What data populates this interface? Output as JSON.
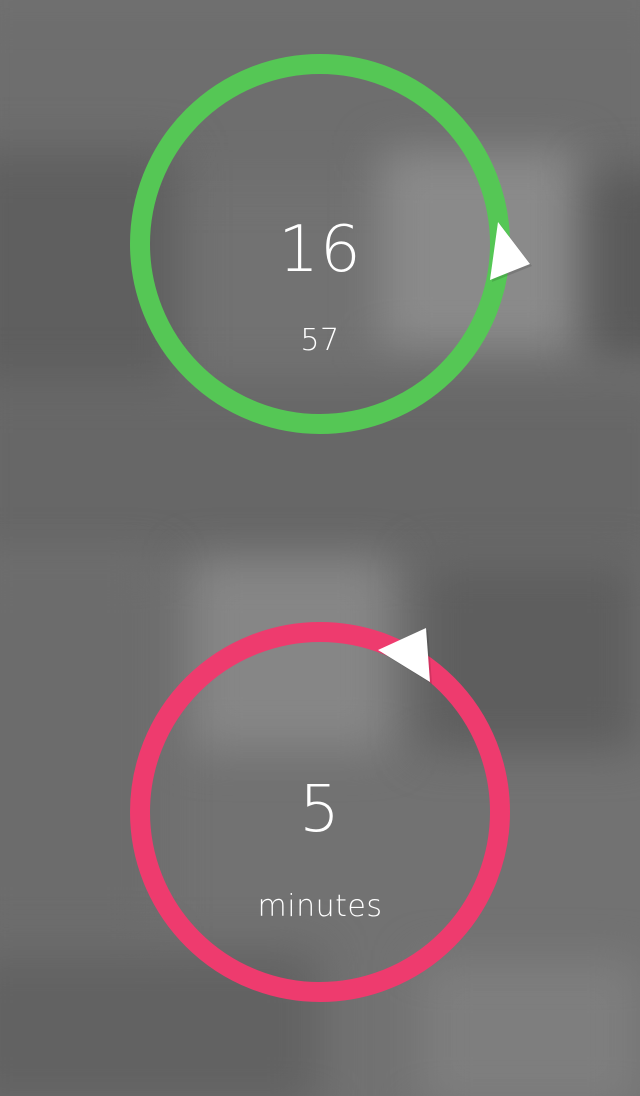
{
  "colors": {
    "background": "#727272",
    "elapsed_ring": "#55c755",
    "interval_ring": "#ee3b6e",
    "handle": "#ffffff",
    "text": "#ffffff"
  },
  "elapsed_timer": {
    "value": "16",
    "sub_value": "57",
    "handle_icon": "triangle-handle-icon"
  },
  "interval_timer": {
    "value": "5",
    "unit_label": "minutes",
    "handle_icon": "triangle-handle-icon"
  }
}
